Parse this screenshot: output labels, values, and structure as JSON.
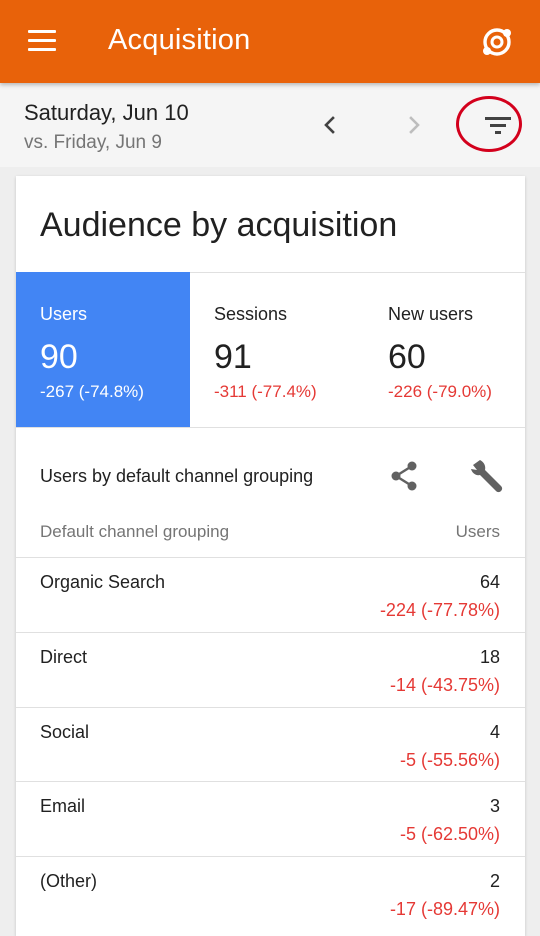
{
  "app_bar": {
    "title": "Acquisition",
    "menu_icon": "hamburger-menu-icon",
    "account_icon": "account-switch-icon",
    "color": "#e8620a"
  },
  "date_bar": {
    "date": "Saturday, Jun 10",
    "compare": "vs. Friday, Jun 9",
    "prev_icon": "chevron-left-icon",
    "next_icon": "chevron-right-icon",
    "filter_icon": "filter-icon"
  },
  "card": {
    "title": "Audience by acquisition",
    "metrics": [
      {
        "label": "Users",
        "value": "90",
        "change": "-267 (-74.8%)",
        "active": true
      },
      {
        "label": "Sessions",
        "value": "91",
        "change": "-311 (-77.4%)",
        "active": false
      },
      {
        "label": "New users",
        "value": "60",
        "change": "-226 (-79.0%)",
        "active": false
      }
    ],
    "section_title": "Users by default channel grouping",
    "share_icon": "share-icon",
    "customize_icon": "wrench-icon",
    "table": {
      "columns": [
        "Default channel grouping",
        "Users"
      ],
      "rows": [
        {
          "name": "Organic Search",
          "value": "64",
          "change": "-224 (-77.78%)"
        },
        {
          "name": "Direct",
          "value": "18",
          "change": "-14 (-43.75%)"
        },
        {
          "name": "Social",
          "value": "4",
          "change": "-5 (-55.56%)"
        },
        {
          "name": "Email",
          "value": "3",
          "change": "-5 (-62.50%)"
        },
        {
          "name": "(Other)",
          "value": "2",
          "change": "-17 (-89.47%)"
        }
      ]
    }
  },
  "colors": {
    "accent_blue": "#4285f4",
    "negative_red": "#e53935",
    "highlight_circle": "#d3001c"
  }
}
